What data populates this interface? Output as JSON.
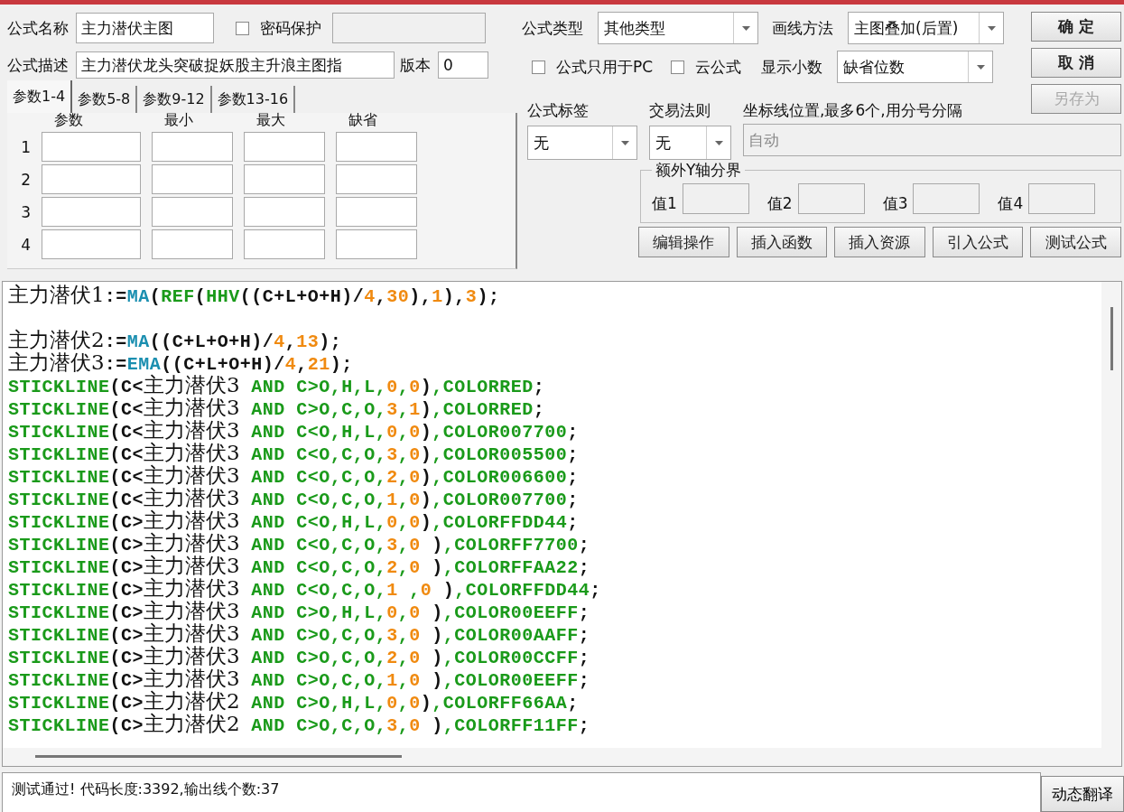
{
  "form": {
    "name": {
      "label": "公式名称",
      "value": "主力潜伏主图"
    },
    "password": {
      "label": "密码保护",
      "checked": false
    },
    "description": {
      "label": "公式描述",
      "value": "主力潜伏龙头突破捉妖股主升浪主图指"
    },
    "version": {
      "label": "版本",
      "value": "0"
    },
    "formula_type": {
      "label": "公式类型",
      "value": "其他类型"
    },
    "draw_method": {
      "label": "画线方法",
      "value": "主图叠加(后置)"
    },
    "pc_only": {
      "label": "公式只用于PC",
      "checked": false
    },
    "cloud": {
      "label": "云公式",
      "checked": false
    },
    "decimals": {
      "label": "显示小数",
      "value": "缺省位数"
    },
    "formula_tag": {
      "label": "公式标签",
      "value": "无"
    },
    "trade_rule": {
      "label": "交易法则",
      "value": "无"
    },
    "axis_lines": {
      "label": "坐标线位置,最多6个,用分号分隔",
      "value": "自动",
      "disabled": true
    },
    "extra_y": {
      "title": "额外Y轴分界",
      "fields": [
        "值1",
        "值2",
        "值3",
        "值4"
      ]
    }
  },
  "dialog_buttons": [
    {
      "label": "确 定",
      "disabled": false
    },
    {
      "label": "取 消",
      "disabled": false
    },
    {
      "label": "另存为",
      "disabled": true
    }
  ],
  "tabs": [
    {
      "label": "参数1-4",
      "selected": true
    },
    {
      "label": "参数5-8",
      "selected": false
    },
    {
      "label": "参数9-12",
      "selected": false
    },
    {
      "label": "参数13-16",
      "selected": false
    }
  ],
  "param_columns": [
    "参数",
    "最小",
    "最大",
    "缺省"
  ],
  "param_rows": [
    "1",
    "2",
    "3",
    "4"
  ],
  "action_buttons": [
    "编辑操作",
    "插入函数",
    "插入资源",
    "引入公式",
    "测试公式"
  ],
  "code_lines": [
    {
      "kind": "code",
      "segments": [
        {
          "kind": "name",
          "text": "主力潜伏1"
        },
        {
          "kind": "op",
          "text": ":="
        },
        {
          "kind": "func",
          "text": "MA"
        },
        {
          "kind": "op",
          "text": "("
        },
        {
          "kind": "kw",
          "text": "REF"
        },
        {
          "kind": "op",
          "text": "("
        },
        {
          "kind": "kw",
          "text": "HHV"
        },
        {
          "kind": "op",
          "text": "((C+L+O+H)/"
        },
        {
          "kind": "num",
          "text": "4"
        },
        {
          "kind": "op",
          "text": ","
        },
        {
          "kind": "num",
          "text": "30"
        },
        {
          "kind": "op",
          "text": "),"
        },
        {
          "kind": "num",
          "text": "1"
        },
        {
          "kind": "op",
          "text": "),"
        },
        {
          "kind": "num",
          "text": "3"
        },
        {
          "kind": "op",
          "text": ");"
        }
      ]
    },
    {
      "kind": "blank"
    },
    {
      "kind": "code",
      "segments": [
        {
          "kind": "name",
          "text": "主力潜伏2"
        },
        {
          "kind": "op",
          "text": ":="
        },
        {
          "kind": "func",
          "text": "MA"
        },
        {
          "kind": "op",
          "text": "((C+L+O+H)/"
        },
        {
          "kind": "num",
          "text": "4"
        },
        {
          "kind": "op",
          "text": ","
        },
        {
          "kind": "num",
          "text": "13"
        },
        {
          "kind": "op",
          "text": ");"
        }
      ]
    },
    {
      "kind": "code",
      "segments": [
        {
          "kind": "name",
          "text": "主力潜伏3"
        },
        {
          "kind": "op",
          "text": ":="
        },
        {
          "kind": "func",
          "text": "EMA"
        },
        {
          "kind": "op",
          "text": "((C+L+O+H)/"
        },
        {
          "kind": "num",
          "text": "4"
        },
        {
          "kind": "op",
          "text": ","
        },
        {
          "kind": "num",
          "text": "21"
        },
        {
          "kind": "op",
          "text": ");"
        }
      ]
    },
    {
      "kind": "code",
      "segments": [
        {
          "kind": "kw",
          "text": "STICKLINE"
        },
        {
          "kind": "op",
          "text": "(C<"
        },
        {
          "kind": "name",
          "text": "主力潜伏3"
        },
        {
          "kind": "kw",
          "text": " AND C>O,H,L,"
        },
        {
          "kind": "num",
          "text": "0"
        },
        {
          "kind": "kw",
          "text": ","
        },
        {
          "kind": "num",
          "text": "0"
        },
        {
          "kind": "op",
          "text": ")"
        },
        {
          "kind": "kw",
          "text": ",COLORRED"
        },
        {
          "kind": "op",
          "text": ";"
        }
      ]
    },
    {
      "kind": "code",
      "segments": [
        {
          "kind": "kw",
          "text": "STICKLINE"
        },
        {
          "kind": "op",
          "text": "(C<"
        },
        {
          "kind": "name",
          "text": "主力潜伏3"
        },
        {
          "kind": "kw",
          "text": " AND C>O,C,O,"
        },
        {
          "kind": "num",
          "text": "3"
        },
        {
          "kind": "kw",
          "text": ","
        },
        {
          "kind": "num",
          "text": "1"
        },
        {
          "kind": "op",
          "text": ")"
        },
        {
          "kind": "kw",
          "text": ",COLORRED"
        },
        {
          "kind": "op",
          "text": ";"
        }
      ]
    },
    {
      "kind": "code",
      "segments": [
        {
          "kind": "kw",
          "text": "STICKLINE"
        },
        {
          "kind": "op",
          "text": "(C<"
        },
        {
          "kind": "name",
          "text": "主力潜伏3"
        },
        {
          "kind": "kw",
          "text": " AND C<O,H,L,"
        },
        {
          "kind": "num",
          "text": "0"
        },
        {
          "kind": "kw",
          "text": ","
        },
        {
          "kind": "num",
          "text": "0"
        },
        {
          "kind": "op",
          "text": ")"
        },
        {
          "kind": "kw",
          "text": ",COLOR007700"
        },
        {
          "kind": "op",
          "text": ";"
        }
      ]
    },
    {
      "kind": "code",
      "segments": [
        {
          "kind": "kw",
          "text": "STICKLINE"
        },
        {
          "kind": "op",
          "text": "(C<"
        },
        {
          "kind": "name",
          "text": "主力潜伏3"
        },
        {
          "kind": "kw",
          "text": " AND C<O,C,O,"
        },
        {
          "kind": "num",
          "text": "3"
        },
        {
          "kind": "kw",
          "text": ","
        },
        {
          "kind": "num",
          "text": "0"
        },
        {
          "kind": "op",
          "text": ")"
        },
        {
          "kind": "kw",
          "text": ",COLOR005500"
        },
        {
          "kind": "op",
          "text": ";"
        }
      ]
    },
    {
      "kind": "code",
      "segments": [
        {
          "kind": "kw",
          "text": "STICKLINE"
        },
        {
          "kind": "op",
          "text": "(C<"
        },
        {
          "kind": "name",
          "text": "主力潜伏3"
        },
        {
          "kind": "kw",
          "text": " AND C<O,C,O,"
        },
        {
          "kind": "num",
          "text": "2"
        },
        {
          "kind": "kw",
          "text": ","
        },
        {
          "kind": "num",
          "text": "0"
        },
        {
          "kind": "op",
          "text": ")"
        },
        {
          "kind": "kw",
          "text": ",COLOR006600"
        },
        {
          "kind": "op",
          "text": ";"
        }
      ]
    },
    {
      "kind": "code",
      "segments": [
        {
          "kind": "kw",
          "text": "STICKLINE"
        },
        {
          "kind": "op",
          "text": "(C<"
        },
        {
          "kind": "name",
          "text": "主力潜伏3"
        },
        {
          "kind": "kw",
          "text": " AND C<O,C,O,"
        },
        {
          "kind": "num",
          "text": "1"
        },
        {
          "kind": "kw",
          "text": ","
        },
        {
          "kind": "num",
          "text": "0"
        },
        {
          "kind": "op",
          "text": ")"
        },
        {
          "kind": "kw",
          "text": ",COLOR007700"
        },
        {
          "kind": "op",
          "text": ";"
        }
      ]
    },
    {
      "kind": "code",
      "segments": [
        {
          "kind": "kw",
          "text": "STICKLINE"
        },
        {
          "kind": "op",
          "text": "(C>"
        },
        {
          "kind": "name",
          "text": "主力潜伏3"
        },
        {
          "kind": "kw",
          "text": " AND C<O,H,L,"
        },
        {
          "kind": "num",
          "text": "0"
        },
        {
          "kind": "kw",
          "text": ","
        },
        {
          "kind": "num",
          "text": "0"
        },
        {
          "kind": "op",
          "text": ")"
        },
        {
          "kind": "kw",
          "text": ",COLORFFDD44"
        },
        {
          "kind": "op",
          "text": ";"
        }
      ]
    },
    {
      "kind": "code",
      "segments": [
        {
          "kind": "kw",
          "text": "STICKLINE"
        },
        {
          "kind": "op",
          "text": "(C>"
        },
        {
          "kind": "name",
          "text": "主力潜伏3"
        },
        {
          "kind": "kw",
          "text": " AND C<O,C,O,"
        },
        {
          "kind": "num",
          "text": "3"
        },
        {
          "kind": "kw",
          "text": ","
        },
        {
          "kind": "num",
          "text": "0"
        },
        {
          "kind": "op",
          "text": " )"
        },
        {
          "kind": "kw",
          "text": ",COLORFF7700"
        },
        {
          "kind": "op",
          "text": ";"
        }
      ]
    },
    {
      "kind": "code",
      "segments": [
        {
          "kind": "kw",
          "text": "STICKLINE"
        },
        {
          "kind": "op",
          "text": "(C>"
        },
        {
          "kind": "name",
          "text": "主力潜伏3"
        },
        {
          "kind": "kw",
          "text": " AND C<O,C,O,"
        },
        {
          "kind": "num",
          "text": "2"
        },
        {
          "kind": "kw",
          "text": ","
        },
        {
          "kind": "num",
          "text": "0"
        },
        {
          "kind": "op",
          "text": " )"
        },
        {
          "kind": "kw",
          "text": ",COLORFFAA22"
        },
        {
          "kind": "op",
          "text": ";"
        }
      ]
    },
    {
      "kind": "code",
      "segments": [
        {
          "kind": "kw",
          "text": "STICKLINE"
        },
        {
          "kind": "op",
          "text": "(C>"
        },
        {
          "kind": "name",
          "text": "主力潜伏3"
        },
        {
          "kind": "kw",
          "text": " AND C<O,C,O,"
        },
        {
          "kind": "num",
          "text": "1"
        },
        {
          "kind": "kw",
          "text": " ,"
        },
        {
          "kind": "num",
          "text": "0"
        },
        {
          "kind": "op",
          "text": " )"
        },
        {
          "kind": "kw",
          "text": ",COLORFFDD44"
        },
        {
          "kind": "op",
          "text": ";"
        }
      ]
    },
    {
      "kind": "code",
      "segments": [
        {
          "kind": "kw",
          "text": "STICKLINE"
        },
        {
          "kind": "op",
          "text": "(C>"
        },
        {
          "kind": "name",
          "text": "主力潜伏3"
        },
        {
          "kind": "kw",
          "text": " AND C>O,H,L,"
        },
        {
          "kind": "num",
          "text": "0"
        },
        {
          "kind": "kw",
          "text": ","
        },
        {
          "kind": "num",
          "text": "0"
        },
        {
          "kind": "op",
          "text": " )"
        },
        {
          "kind": "kw",
          "text": ",COLOR00EEFF"
        },
        {
          "kind": "op",
          "text": ";"
        }
      ]
    },
    {
      "kind": "code",
      "segments": [
        {
          "kind": "kw",
          "text": "STICKLINE"
        },
        {
          "kind": "op",
          "text": "(C>"
        },
        {
          "kind": "name",
          "text": "主力潜伏3"
        },
        {
          "kind": "kw",
          "text": " AND C>O,C,O,"
        },
        {
          "kind": "num",
          "text": "3"
        },
        {
          "kind": "kw",
          "text": ","
        },
        {
          "kind": "num",
          "text": "0"
        },
        {
          "kind": "op",
          "text": " )"
        },
        {
          "kind": "kw",
          "text": ",COLOR00AAFF"
        },
        {
          "kind": "op",
          "text": ";"
        }
      ]
    },
    {
      "kind": "code",
      "segments": [
        {
          "kind": "kw",
          "text": "STICKLINE"
        },
        {
          "kind": "op",
          "text": "(C>"
        },
        {
          "kind": "name",
          "text": "主力潜伏3"
        },
        {
          "kind": "kw",
          "text": " AND C>O,C,O,"
        },
        {
          "kind": "num",
          "text": "2"
        },
        {
          "kind": "kw",
          "text": ","
        },
        {
          "kind": "num",
          "text": "0"
        },
        {
          "kind": "op",
          "text": " )"
        },
        {
          "kind": "kw",
          "text": ",COLOR00CCFF"
        },
        {
          "kind": "op",
          "text": ";"
        }
      ]
    },
    {
      "kind": "code",
      "segments": [
        {
          "kind": "kw",
          "text": "STICKLINE"
        },
        {
          "kind": "op",
          "text": "(C>"
        },
        {
          "kind": "name",
          "text": "主力潜伏3"
        },
        {
          "kind": "kw",
          "text": " AND C>O,C,O,"
        },
        {
          "kind": "num",
          "text": "1"
        },
        {
          "kind": "kw",
          "text": ","
        },
        {
          "kind": "num",
          "text": "0"
        },
        {
          "kind": "op",
          "text": " )"
        },
        {
          "kind": "kw",
          "text": ",COLOR00EEFF"
        },
        {
          "kind": "op",
          "text": ";"
        }
      ]
    },
    {
      "kind": "code",
      "segments": [
        {
          "kind": "kw",
          "text": "STICKLINE"
        },
        {
          "kind": "op",
          "text": "(C>"
        },
        {
          "kind": "name",
          "text": "主力潜伏2"
        },
        {
          "kind": "kw",
          "text": " AND C>O,H,L,"
        },
        {
          "kind": "num",
          "text": "0"
        },
        {
          "kind": "kw",
          "text": ","
        },
        {
          "kind": "num",
          "text": "0"
        },
        {
          "kind": "op",
          "text": ")"
        },
        {
          "kind": "kw",
          "text": ",COLORFF66AA"
        },
        {
          "kind": "op",
          "text": ";"
        }
      ]
    },
    {
      "kind": "code",
      "segments": [
        {
          "kind": "kw",
          "text": "STICKLINE"
        },
        {
          "kind": "op",
          "text": "(C>"
        },
        {
          "kind": "name",
          "text": "主力潜伏2"
        },
        {
          "kind": "kw",
          "text": " AND C>O,C,O,"
        },
        {
          "kind": "num",
          "text": "3"
        },
        {
          "kind": "kw",
          "text": ","
        },
        {
          "kind": "num",
          "text": "0"
        },
        {
          "kind": "op",
          "text": " )"
        },
        {
          "kind": "kw",
          "text": ",COLORFF11FF"
        },
        {
          "kind": "op",
          "text": ";"
        }
      ]
    }
  ],
  "status": {
    "text": "测试通过! 代码长度:3392,输出线个数:37",
    "button": "动态翻译"
  }
}
